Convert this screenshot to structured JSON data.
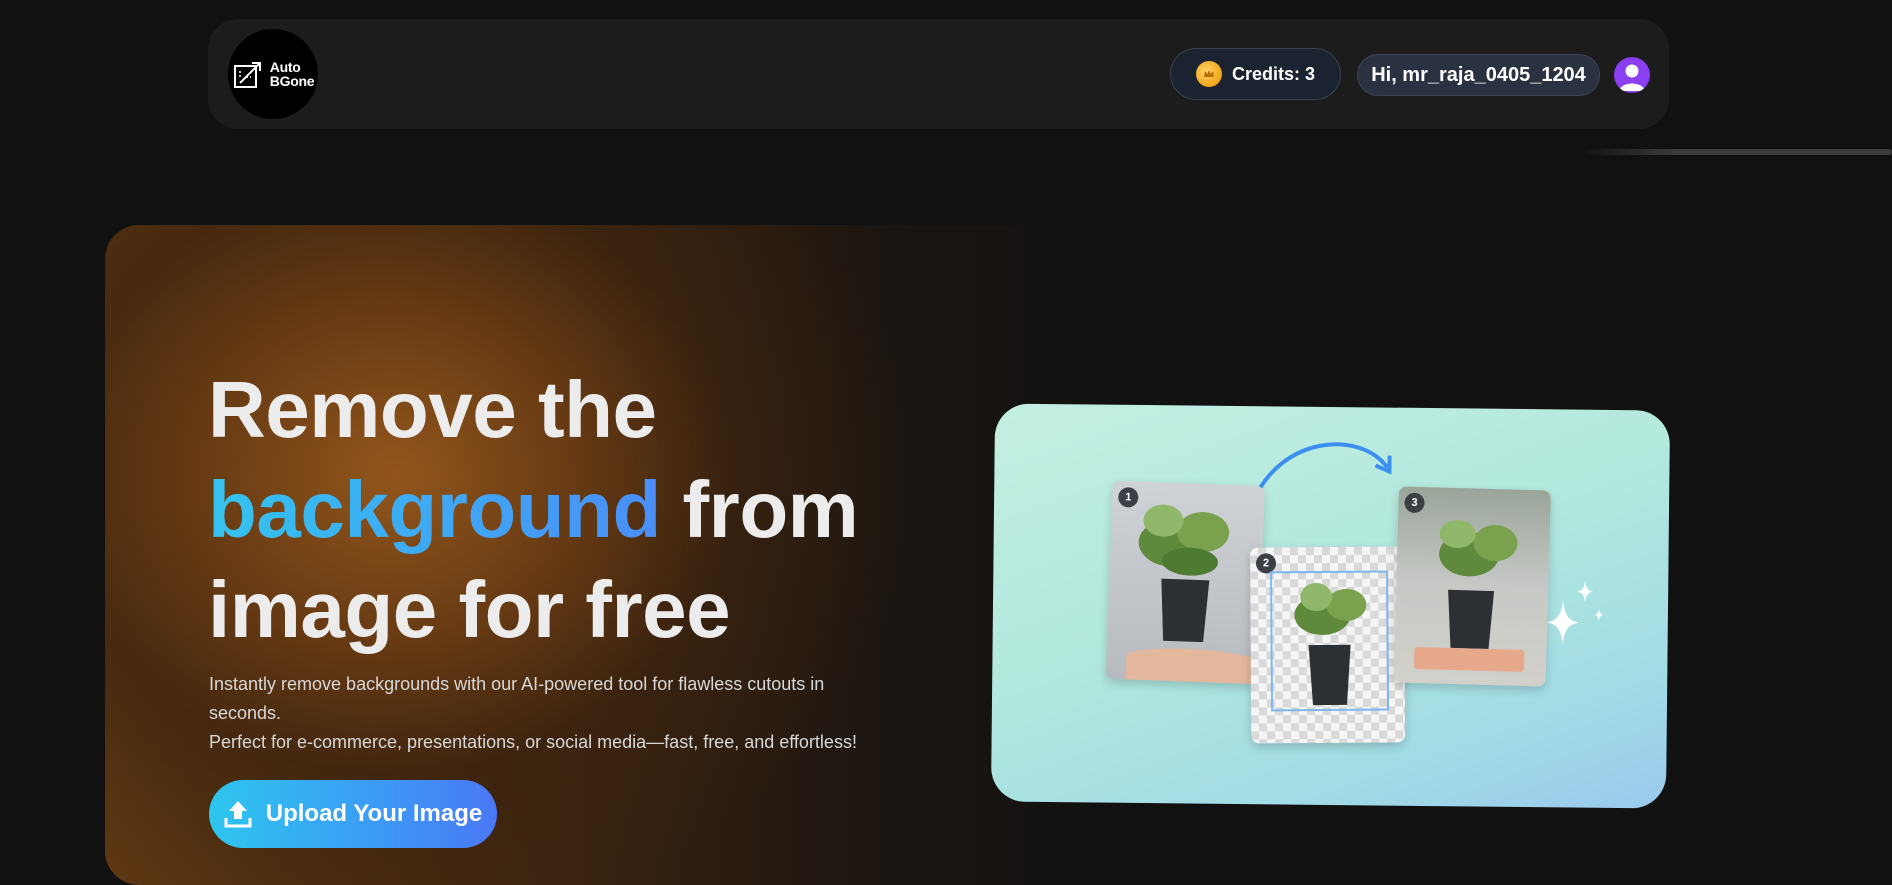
{
  "header": {
    "logo": {
      "line1": "Auto",
      "line2": "BGone",
      "icon": "crop-arrow-icon"
    },
    "credits": {
      "label": "Credits: 3",
      "icon": "coin-icon"
    },
    "user_greeting": "Hi, mr_raja_0405_1204",
    "avatar_icon": "user-avatar-icon"
  },
  "hero": {
    "title_part1": "Remove the",
    "title_accent": "background",
    "title_part2": " from",
    "title_part3": "image for free",
    "description_line1": "Instantly remove backgrounds with our AI-powered tool for flawless cutouts in seconds.",
    "description_line2": "Perfect for e-commerce, presentations, or social media—fast, free, and effortless!",
    "upload_button_label": "Upload Your Image",
    "upload_icon": "upload-icon"
  },
  "illustration": {
    "steps": [
      "1",
      "2",
      "3"
    ],
    "icons": [
      "curved-arrow-icon",
      "sparkle-icon"
    ]
  },
  "colors": {
    "accent_gradient_start": "#34c3ee",
    "accent_gradient_end": "#4a78f5",
    "hero_warm": "#96581c",
    "background": "#111111",
    "avatar": "#8a3ff0"
  }
}
